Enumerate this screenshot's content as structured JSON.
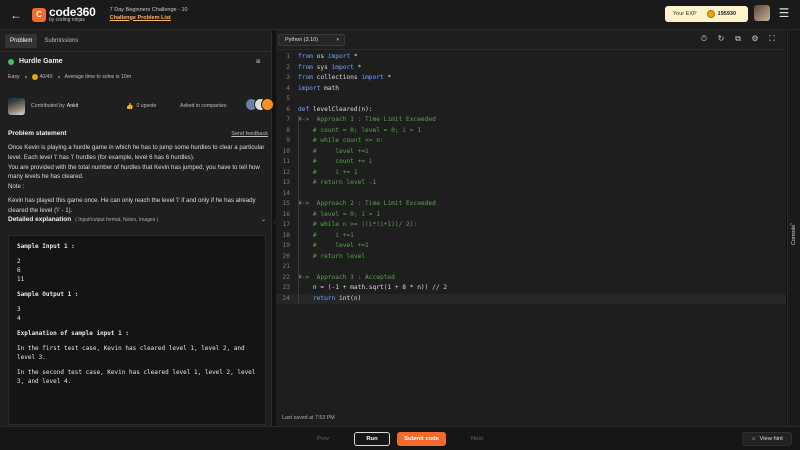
{
  "header": {
    "logo_mark": "C",
    "logo_main": "code360",
    "logo_sub": "by coding ninjas",
    "crumb_top": "7 Day Beginners Challenge - 10",
    "crumb_link": "Challenge Problem List",
    "exp_label": "Your EXP",
    "exp_value": "195930"
  },
  "tabs": [
    "Problem",
    "Submissions"
  ],
  "problem": {
    "title": "Hurdle Game",
    "difficulty": "Easy",
    "score": "40/40",
    "avg_time": "Average time to solve is 10m",
    "contributed_label": "Contributed by",
    "author": "Ankit",
    "upvotes": "0 upvote",
    "asked_label": "Asked in companies",
    "statement_title": "Problem statement",
    "send_feedback": "Send feedback",
    "desc": [
      "Once Kevin is playing a hurdle game in which he has to jump some hurdles to clear a particular level. Each level 'i' has 'i' hurdles (for example, level 6 has 6 hurdles).",
      "You are provided with the total number of hurdles that Kevin has jumped, you have to tell how many levels he has cleared.",
      "Note :",
      "Kevin has played this game once. He can only reach the level 'i' if and only if he has already cleared the level ('i' - 1)."
    ],
    "detail_title": "Detailed explanation",
    "detail_sub": "( Input/output format, Notes, Images )"
  },
  "sample": {
    "input_label": "Sample Input 1 :",
    "inputs": [
      "2",
      "6",
      "11"
    ],
    "output_label": "Sample Output 1 :",
    "outputs": [
      "3",
      "4"
    ],
    "expl_label": "Explanation of sample input 1 :",
    "expl1": "In the first test case, Kevin has cleared level 1, level 2, and level 3.",
    "expl2": "In the second test case, Kevin has cleared level 1, level 2, level 3, and level 4."
  },
  "editor": {
    "language": "Python (3.10)",
    "saved": "Last saved at 7:53 PM",
    "lines": [
      [
        [
          "kw",
          "from"
        ],
        [
          "tx",
          " os "
        ],
        [
          "kw",
          "import"
        ],
        [
          "tx",
          " *"
        ]
      ],
      [
        [
          "kw",
          "from"
        ],
        [
          "tx",
          " sys "
        ],
        [
          "kw",
          "import"
        ],
        [
          "tx",
          " *"
        ]
      ],
      [
        [
          "kw",
          "from"
        ],
        [
          "tx",
          " collections "
        ],
        [
          "kw",
          "import"
        ],
        [
          "tx",
          " *"
        ]
      ],
      [
        [
          "kw",
          "import"
        ],
        [
          "tx",
          " math"
        ]
      ],
      [],
      [
        [
          "kw",
          "def"
        ],
        [
          "tx",
          " levelCleared(n):"
        ]
      ],
      [
        [
          "cm",
          "#->  Approach 1 : Time Limit Exceeded"
        ]
      ],
      [
        [
          "cm",
          "    # count = 0; level = 0; i = 1"
        ]
      ],
      [
        [
          "cm",
          "    # while count <= n:"
        ]
      ],
      [
        [
          "cm",
          "    #     level +=1"
        ]
      ],
      [
        [
          "cm",
          "    #     count += i"
        ]
      ],
      [
        [
          "cm",
          "    #     i += 1"
        ]
      ],
      [
        [
          "cm",
          "    # return level -1"
        ]
      ],
      [],
      [
        [
          "cm",
          "#->  Approach 2 : Time Limit Exceeded"
        ]
      ],
      [
        [
          "cm",
          "    # level = 0; i = 1"
        ]
      ],
      [
        [
          "cm",
          "    # while n >= ((i*(i+1))/ 2):"
        ]
      ],
      [
        [
          "cm",
          "    #     i +=1"
        ]
      ],
      [
        [
          "cm",
          "    #     level +=1"
        ]
      ],
      [
        [
          "cm",
          "    # return level"
        ]
      ],
      [],
      [
        [
          "cm",
          "#->  Approach 3 : Accepted"
        ]
      ],
      [
        [
          "tx",
          "    n = (-1 + math.sqrt(1 + 8 * n)) // 2"
        ]
      ],
      [
        [
          "kw",
          "    return"
        ],
        [
          "tx",
          " int(n)"
        ]
      ]
    ]
  },
  "console_label": "Console",
  "bottom": {
    "prev": "Prev",
    "run": "Run",
    "submit": "Submit code",
    "next": "Next",
    "hint": "View hint"
  }
}
